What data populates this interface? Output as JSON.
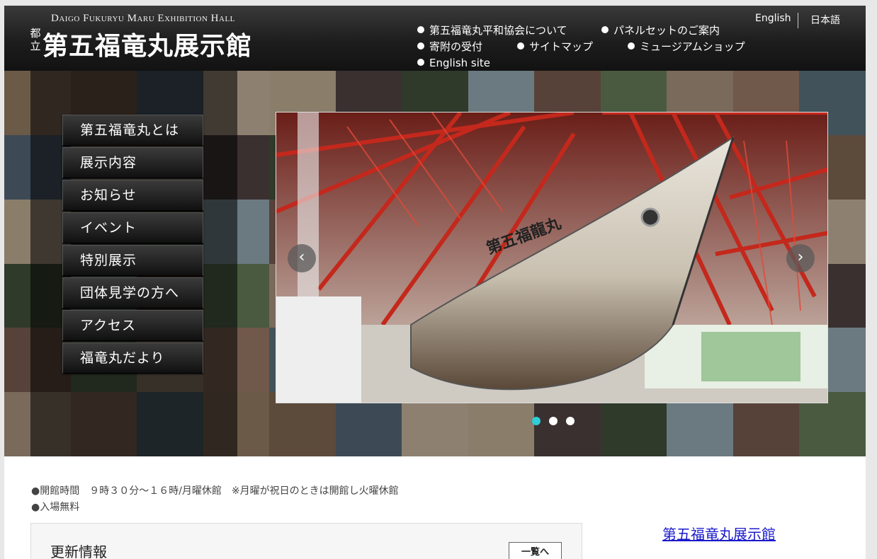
{
  "header": {
    "logo_en": "Daigo Fukuryu Maru Exhibition Hall",
    "logo_small": "都立",
    "logo_jp": "第五福竜丸展示館",
    "nav": [
      {
        "label": "第五福竜丸平和協会について"
      },
      {
        "label": "パネルセットのご案内"
      },
      {
        "label": "寄附の受付"
      },
      {
        "label": "サイトマップ"
      },
      {
        "label": "ミュージアムショップ"
      },
      {
        "label": "English site"
      }
    ],
    "lang_en": "English",
    "lang_jp": "日本語"
  },
  "menu": [
    {
      "label": "第五福竜丸とは"
    },
    {
      "label": "展示内容"
    },
    {
      "label": "お知らせ"
    },
    {
      "label": "イベント"
    },
    {
      "label": "特別展示"
    },
    {
      "label": "団体見学の方へ"
    },
    {
      "label": "アクセス"
    },
    {
      "label": "福竜丸だより"
    }
  ],
  "slider": {
    "ship_name": "第五福龍丸",
    "prev_symbol": "‹",
    "next_symbol": "›",
    "dots": 3,
    "active_dot": 0,
    "active_color": "#2ecfd6"
  },
  "info": {
    "hours": "●開館時間　９時３０分～１６時/月曜休館　※月曜が祝日のときは開館し火曜休館",
    "admission": "●入場無料"
  },
  "news": {
    "title": "更新情報",
    "list_button": "一覧へ"
  },
  "sidebar": {
    "link": "第五福竜丸展示館"
  }
}
